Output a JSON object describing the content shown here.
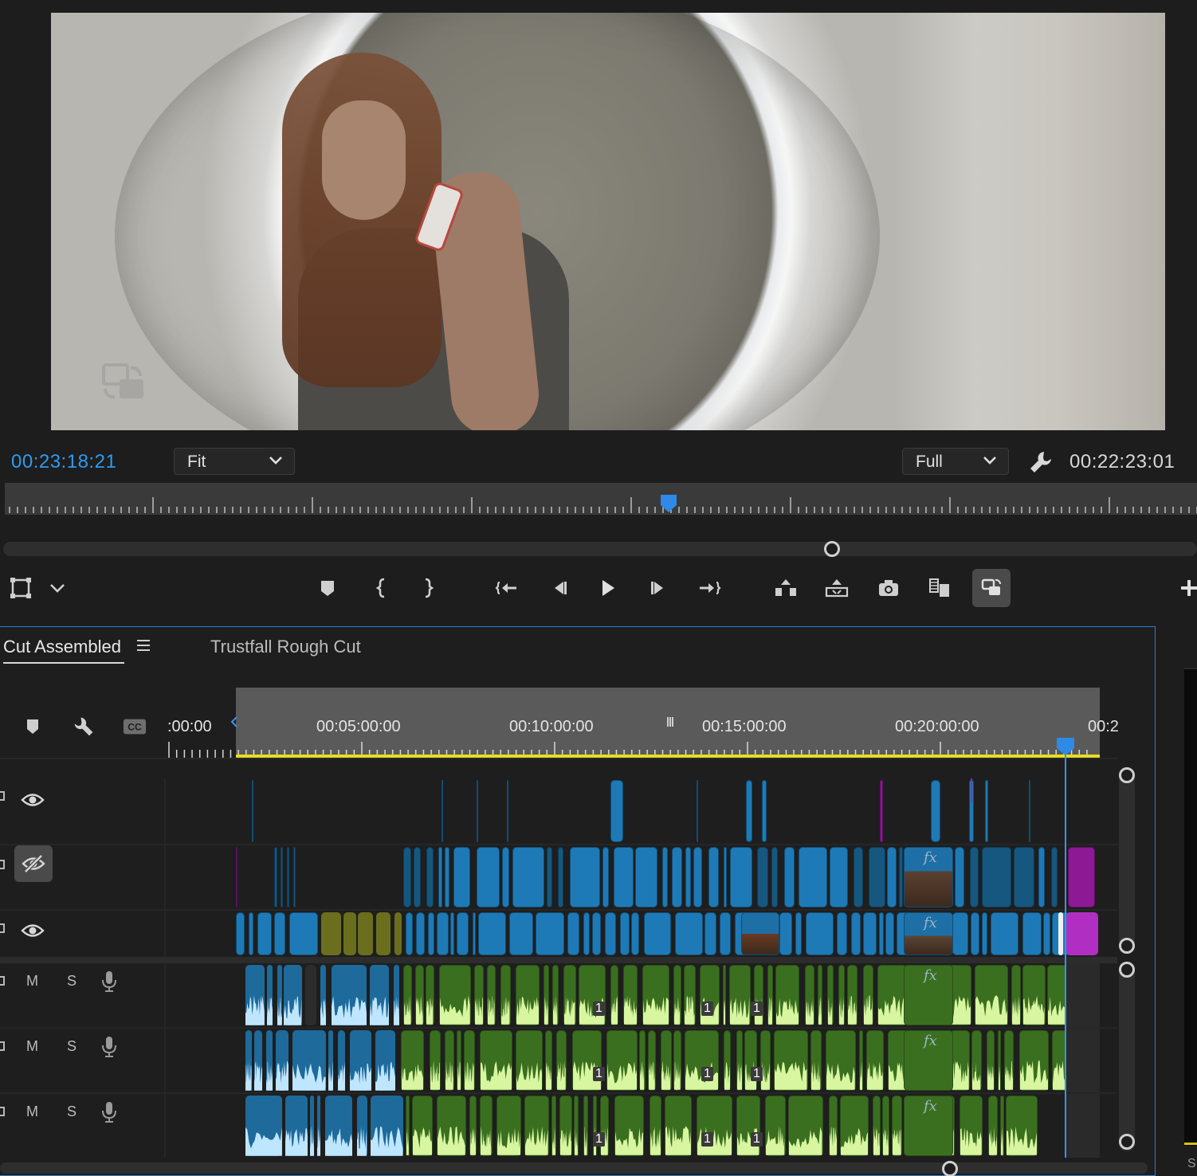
{
  "monitor": {
    "timecode_current": "00:23:18:21",
    "timecode_duration": "00:22:23:01",
    "zoom_select": "Fit",
    "resolution_select": "Full",
    "playhead_position": 0.557
  },
  "transport": {
    "icons": [
      "safe-margins-icon",
      "chevron-down-icon",
      "marker-icon",
      "mark-in-icon",
      "mark-out-icon",
      "go-to-in-icon",
      "step-back-icon",
      "play-icon",
      "step-forward-icon",
      "go-to-out-icon",
      "lift-icon",
      "extract-icon",
      "export-frame-icon",
      "comparison-view-icon",
      "proxy-toggle-icon",
      "add-button-icon"
    ]
  },
  "timeline": {
    "tabs": [
      {
        "label": "Cut Assembled",
        "active": true
      },
      {
        "label": "Trustfall Rough Cut",
        "active": false
      }
    ],
    "ruler": {
      "labels": [
        ":00:00",
        "00:05:00:00",
        "00:10:00:00",
        "00:15:00:00",
        "00:20:00:00",
        "00:2"
      ]
    },
    "tracks": {
      "video": [
        {
          "visible": true
        },
        {
          "visible": false
        },
        {
          "visible": true
        }
      ],
      "audio": [
        {
          "mute": "M",
          "solo": "S"
        },
        {
          "mute": "M",
          "solo": "S"
        },
        {
          "mute": "M",
          "solo": "S"
        }
      ]
    },
    "clip_badges": {
      "channel": "1",
      "effect": "fx"
    },
    "side_label": "S"
  },
  "colors": {
    "timecode_blue": "#2e9bf0",
    "video_clip": "#1e7ab6",
    "audio_clip": "#3a6f1f",
    "nested_sequence": "#8d1a94",
    "work_area_bar": "#e6dd21",
    "playhead": "#3a93e8"
  }
}
